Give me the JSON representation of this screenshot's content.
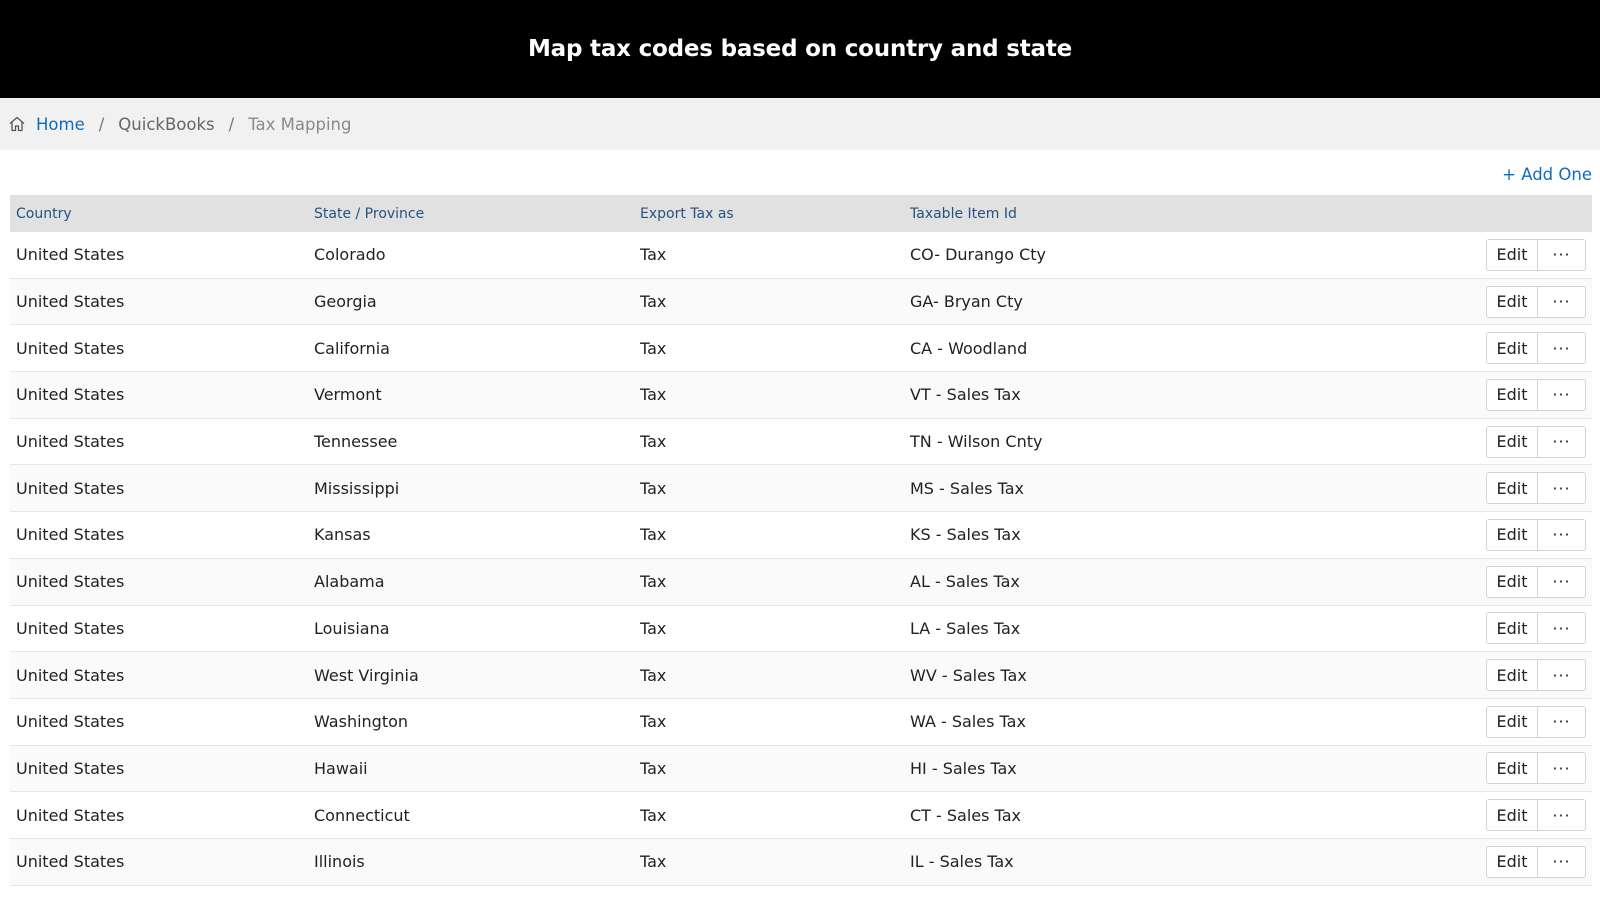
{
  "header": {
    "title": "Map tax codes based on country and state"
  },
  "breadcrumb": {
    "home": "Home",
    "separator": "/",
    "items": [
      "QuickBooks",
      "Tax Mapping"
    ]
  },
  "toolbar": {
    "add_label": "+ Add One"
  },
  "colors": {
    "accent": "#0f6cbd",
    "header_bg": "#000000",
    "table_header_text": "#25527e"
  },
  "table": {
    "columns": [
      "Country",
      "State / Province",
      "Export Tax as",
      "Taxable Item Id"
    ],
    "edit_label": "Edit",
    "more_label": "···",
    "rows": [
      {
        "country": "United States",
        "state": "Colorado",
        "export": "Tax",
        "item": "CO- Durango Cty"
      },
      {
        "country": "United States",
        "state": "Georgia",
        "export": "Tax",
        "item": "GA- Bryan Cty"
      },
      {
        "country": "United States",
        "state": "California",
        "export": "Tax",
        "item": "CA - Woodland"
      },
      {
        "country": "United States",
        "state": "Vermont",
        "export": "Tax",
        "item": "VT - Sales Tax"
      },
      {
        "country": "United States",
        "state": "Tennessee",
        "export": "Tax",
        "item": "TN - Wilson Cnty"
      },
      {
        "country": "United States",
        "state": "Mississippi",
        "export": "Tax",
        "item": "MS - Sales Tax"
      },
      {
        "country": "United States",
        "state": "Kansas",
        "export": "Tax",
        "item": "KS - Sales Tax"
      },
      {
        "country": "United States",
        "state": "Alabama",
        "export": "Tax",
        "item": "AL - Sales Tax"
      },
      {
        "country": "United States",
        "state": "Louisiana",
        "export": "Tax",
        "item": "LA - Sales Tax"
      },
      {
        "country": "United States",
        "state": "West Virginia",
        "export": "Tax",
        "item": "WV - Sales Tax"
      },
      {
        "country": "United States",
        "state": "Washington",
        "export": "Tax",
        "item": "WA - Sales Tax"
      },
      {
        "country": "United States",
        "state": "Hawaii",
        "export": "Tax",
        "item": "HI - Sales Tax"
      },
      {
        "country": "United States",
        "state": "Connecticut",
        "export": "Tax",
        "item": "CT - Sales Tax"
      },
      {
        "country": "United States",
        "state": "Illinois",
        "export": "Tax",
        "item": "IL - Sales Tax"
      }
    ]
  }
}
